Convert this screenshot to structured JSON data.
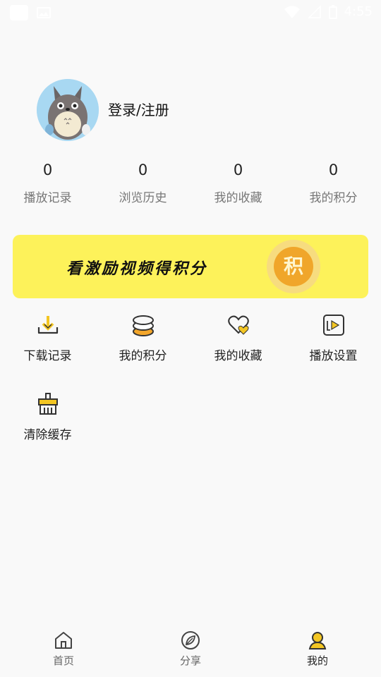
{
  "status_bar": {
    "time": "4:55"
  },
  "profile": {
    "login_label": "登录/注册"
  },
  "stats": [
    {
      "value": "0",
      "label": "播放记录"
    },
    {
      "value": "0",
      "label": "浏览历史"
    },
    {
      "value": "0",
      "label": "我的收藏"
    },
    {
      "value": "0",
      "label": "我的积分"
    }
  ],
  "banner": {
    "text": "看激励视频得积分",
    "coin_label": "积"
  },
  "menu": [
    {
      "label": "下载记录",
      "icon": "download-icon"
    },
    {
      "label": "我的积分",
      "icon": "coins-icon"
    },
    {
      "label": "我的收藏",
      "icon": "heart-icon"
    },
    {
      "label": "播放设置",
      "icon": "play-settings-icon"
    },
    {
      "label": "清除缓存",
      "icon": "clear-cache-icon"
    }
  ],
  "bottom_nav": [
    {
      "label": "首页",
      "icon": "home-icon"
    },
    {
      "label": "分享",
      "icon": "compass-leaf-icon"
    },
    {
      "label": "我的",
      "icon": "user-icon",
      "active": true
    }
  ],
  "colors": {
    "accent": "#fdf25a",
    "coin": "#f0a62a",
    "background": "#f9f9f9"
  }
}
